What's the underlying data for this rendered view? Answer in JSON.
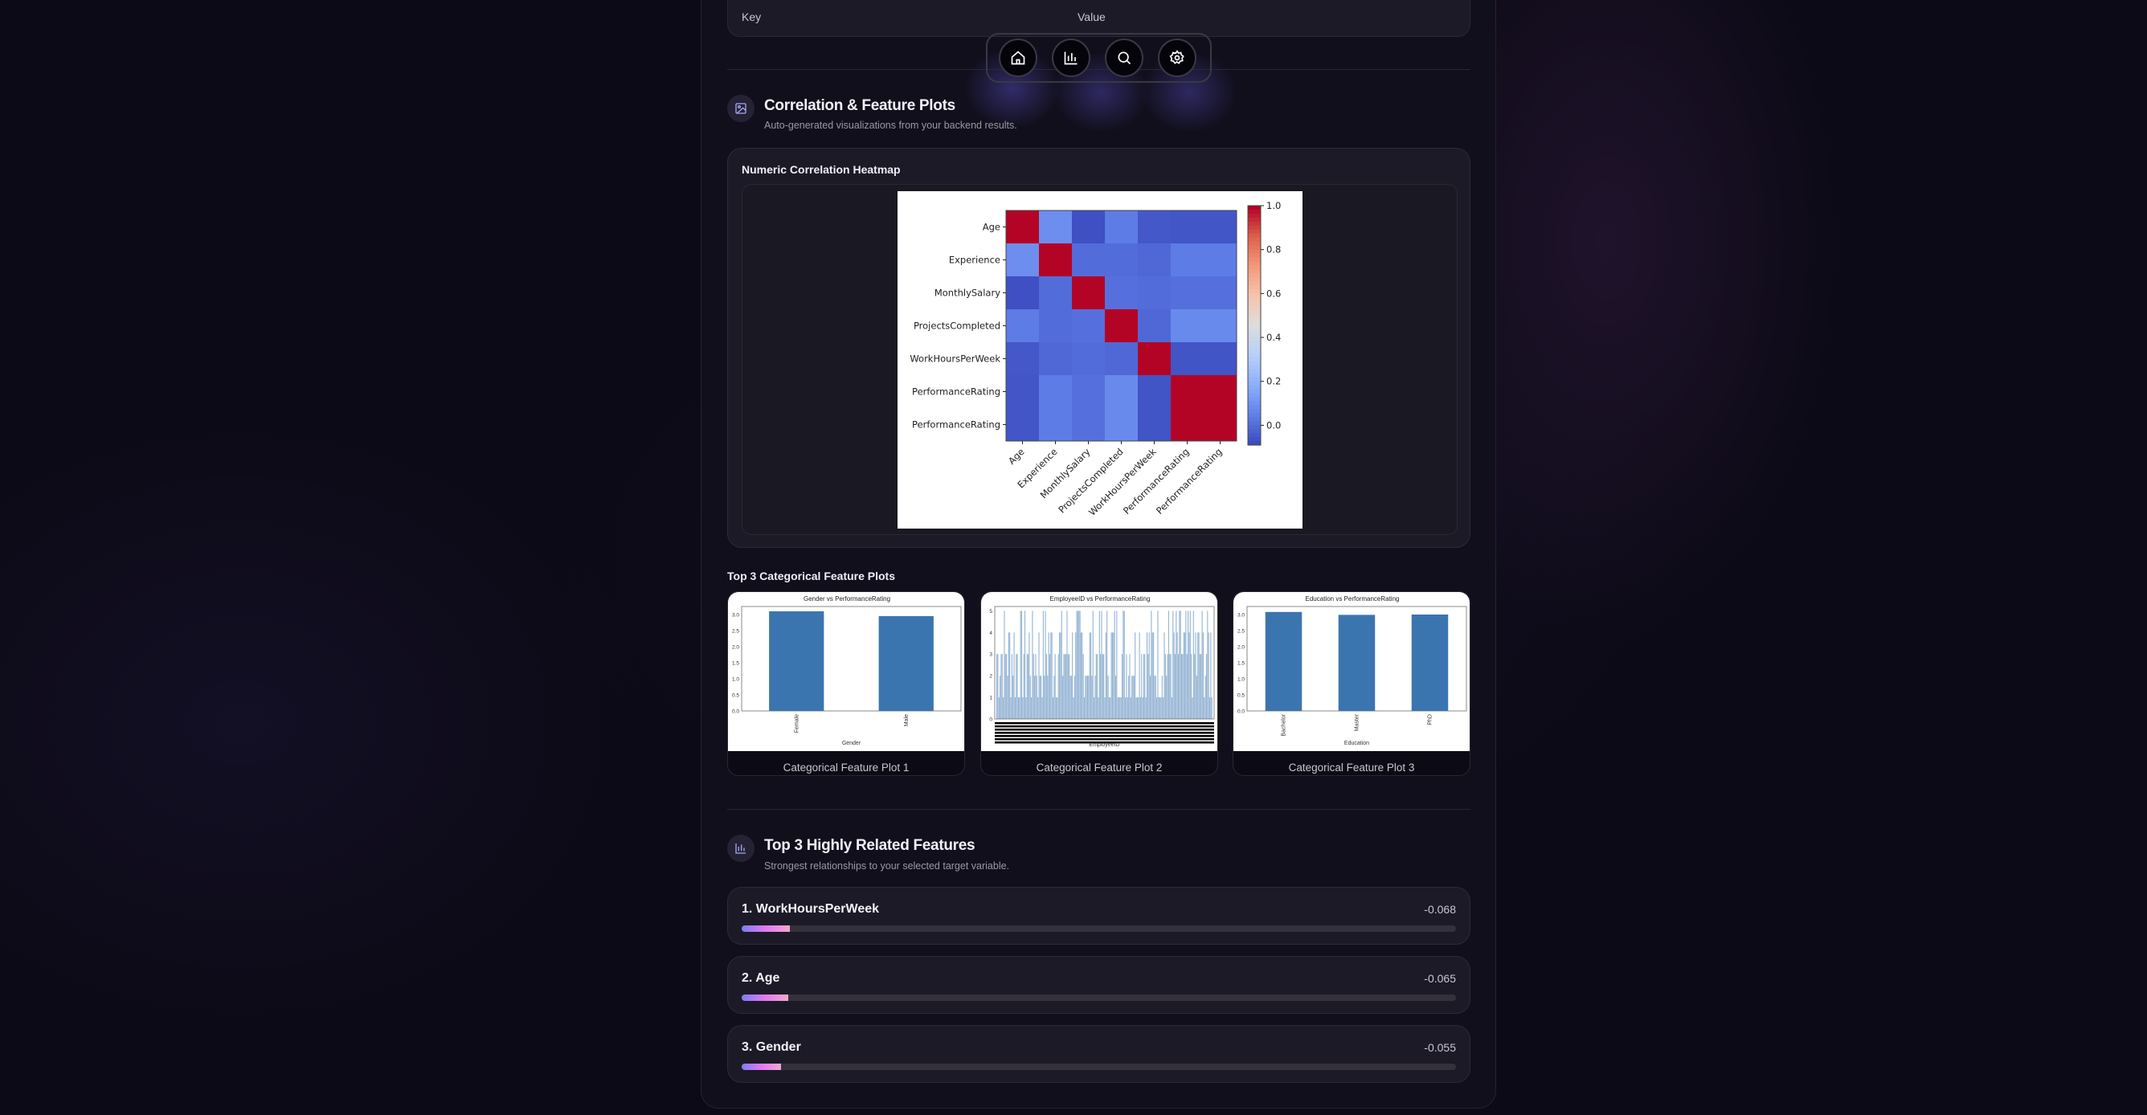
{
  "table_header": {
    "key": "Key",
    "value": "Value"
  },
  "nav": {
    "items": [
      {
        "icon": "home-icon"
      },
      {
        "icon": "bar-chart-icon"
      },
      {
        "icon": "search-icon"
      },
      {
        "icon": "gear-icon"
      }
    ]
  },
  "plots_section": {
    "title": "Correlation & Feature Plots",
    "subtitle": "Auto-generated visualizations from your backend results.",
    "icon": "image-icon"
  },
  "heatmap_card": {
    "title": "Numeric Correlation Heatmap"
  },
  "categorical": {
    "title": "Top 3 Categorical Feature Plots",
    "labels": [
      "Categorical Feature Plot 1",
      "Categorical Feature Plot 2",
      "Categorical Feature Plot 3"
    ]
  },
  "related_section": {
    "title": "Top 3 Highly Related Features",
    "subtitle": "Strongest relationships to your selected target variable.",
    "icon": "bar-chart-icon",
    "features": [
      {
        "label": "1. WorkHoursPerWeek",
        "value": "-0.068",
        "strength": 0.068
      },
      {
        "label": "2. Age",
        "value": "-0.065",
        "strength": 0.065
      },
      {
        "label": "3. Gender",
        "value": "-0.055",
        "strength": 0.055
      }
    ]
  },
  "colors": {
    "accent_gradient": [
      "#7d7cf5",
      "#e27af0",
      "#f0a8d0"
    ],
    "bar": "#3b75af"
  },
  "chart_data": [
    {
      "type": "heatmap",
      "labels": [
        "Age",
        "Experience",
        "MonthlySalary",
        "ProjectsCompleted",
        "WorkHoursPerWeek",
        "PerformanceRating",
        "PerformanceRating"
      ],
      "values": [
        [
          1,
          0.08,
          -0.08,
          0.03,
          -0.06,
          -0.065,
          -0.065
        ],
        [
          0.08,
          1,
          -0.01,
          -0.01,
          -0.02,
          0.03,
          0.03
        ],
        [
          -0.08,
          -0.01,
          1,
          0.0,
          -0.01,
          0.0,
          0.0
        ],
        [
          0.03,
          -0.01,
          0.0,
          1,
          -0.02,
          0.07,
          0.07
        ],
        [
          -0.06,
          -0.02,
          -0.01,
          -0.02,
          1,
          -0.068,
          -0.068
        ],
        [
          -0.065,
          0.03,
          0.0,
          0.07,
          -0.068,
          1,
          1
        ],
        [
          -0.065,
          0.03,
          0.0,
          0.07,
          -0.068,
          1,
          1
        ]
      ],
      "colormap": "coolwarm",
      "vlim": [
        -0.09,
        1.0
      ],
      "colorbar_ticks": [
        "0.0",
        "0.2",
        "0.4",
        "0.6",
        "0.8",
        "1.0"
      ]
    },
    {
      "type": "bar",
      "title": "Gender vs PerformanceRating",
      "xlabel": "Gender",
      "categories": [
        "Female",
        "Male"
      ],
      "values": [
        3.1,
        2.95
      ],
      "yticks": [
        "0.0",
        "0.5",
        "1.0",
        "1.5",
        "2.0",
        "2.5",
        "3.0"
      ],
      "ylim": [
        0,
        3.25
      ]
    },
    {
      "type": "bar",
      "title": "EmployeeID vs PerformanceRating",
      "xlabel": "EmployeeID",
      "yticks": [
        "0",
        "1",
        "2",
        "3",
        "4",
        "5"
      ],
      "ylim": [
        0,
        5.2
      ]
    },
    {
      "type": "bar",
      "title": "Education vs PerformanceRating",
      "xlabel": "Education",
      "categories": [
        "Bachelor",
        "Master",
        "PhD"
      ],
      "values": [
        3.08,
        2.99,
        3.0
      ],
      "yticks": [
        "0.0",
        "0.5",
        "1.0",
        "1.5",
        "2.0",
        "2.5",
        "3.0"
      ],
      "ylim": [
        0,
        3.25
      ]
    }
  ]
}
